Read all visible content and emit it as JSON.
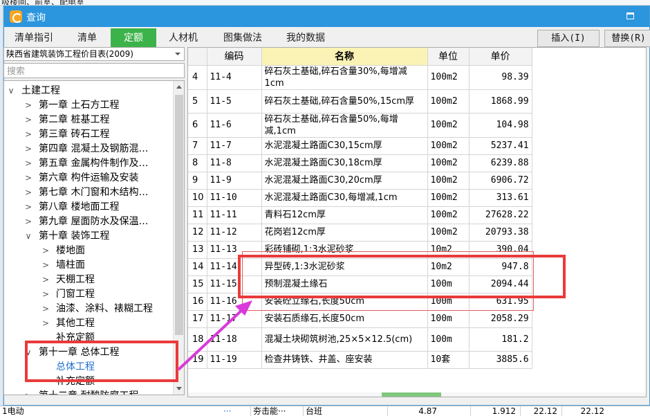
{
  "background": {
    "top_text": "吸楼间、前室、配电室",
    "bottom_cells": [
      "1电动",
      "···",
      "夯击能···",
      "台班",
      "4.87",
      "1.912",
      "22.12",
      "22.12"
    ]
  },
  "window": {
    "title": "查询",
    "logo_icon": "app-logo-icon",
    "maximize_icon": "maximize-icon",
    "accent": "#2b95dd"
  },
  "tabs": [
    {
      "label": "清单指引",
      "active": false
    },
    {
      "label": "清单",
      "active": false
    },
    {
      "label": "定额",
      "active": true
    },
    {
      "label": "人材机",
      "active": false
    },
    {
      "label": "图集做法",
      "active": false
    },
    {
      "label": "我的数据",
      "active": false
    }
  ],
  "buttons": {
    "insert": "插入(I)",
    "replace": "替换(R)"
  },
  "library_select": "陕西省建筑装饰工程价目表(2009)",
  "search_placeholder": "搜索",
  "tree": [
    {
      "label": "土建工程",
      "chev": "∨",
      "level": 0,
      "link": false
    },
    {
      "label": "第一章 土石方工程",
      "chev": ">",
      "level": 1,
      "link": false
    },
    {
      "label": "第二章 桩基工程",
      "chev": ">",
      "level": 1,
      "link": false
    },
    {
      "label": "第三章 砖石工程",
      "chev": ">",
      "level": 1,
      "link": false
    },
    {
      "label": "第四章 混凝土及钢筋混…",
      "chev": ">",
      "level": 1,
      "link": false
    },
    {
      "label": "第五章 金属构件制作及…",
      "chev": ">",
      "level": 1,
      "link": false
    },
    {
      "label": "第六章 构件运输及安装",
      "chev": ">",
      "level": 1,
      "link": false
    },
    {
      "label": "第七章 木门窗和木结构…",
      "chev": ">",
      "level": 1,
      "link": false
    },
    {
      "label": "第八章 楼地面工程",
      "chev": ">",
      "level": 1,
      "link": false
    },
    {
      "label": "第九章 屋面防水及保温…",
      "chev": ">",
      "level": 1,
      "link": false
    },
    {
      "label": "第十章 装饰工程",
      "chev": "∨",
      "level": 1,
      "link": false
    },
    {
      "label": "楼地面",
      "chev": ">",
      "level": 2,
      "link": false
    },
    {
      "label": "墙柱面",
      "chev": ">",
      "level": 2,
      "link": false
    },
    {
      "label": "天棚工程",
      "chev": ">",
      "level": 2,
      "link": false
    },
    {
      "label": "门窗工程",
      "chev": ">",
      "level": 2,
      "link": false
    },
    {
      "label": "油漆、涂料、裱糊工程",
      "chev": ">",
      "level": 2,
      "link": false
    },
    {
      "label": "其他工程",
      "chev": ">",
      "level": 2,
      "link": false
    },
    {
      "label": "补充定额",
      "chev": "",
      "level": 2,
      "link": false
    },
    {
      "label": "第十一章 总体工程",
      "chev": "∨",
      "level": 1,
      "link": false
    },
    {
      "label": "总体工程",
      "chev": "",
      "level": 2,
      "link": true
    },
    {
      "label": "补充定额",
      "chev": "",
      "level": 2,
      "link": false
    },
    {
      "label": "第十二章 耐酸防腐工程",
      "chev": ">",
      "level": 1,
      "link": false
    }
  ],
  "table": {
    "headers": [
      "",
      "编码",
      "名称",
      "单位",
      "单价"
    ],
    "rows": [
      {
        "idx": "4",
        "code": "11-4",
        "name": "碎石灰土基础,碎石含量30%,每增减1cm",
        "unit": "100m2",
        "price": "98.39"
      },
      {
        "idx": "5",
        "code": "11-5",
        "name": "碎石灰土基础,碎石含量50%,15cm厚",
        "unit": "100m2",
        "price": "1868.99"
      },
      {
        "idx": "6",
        "code": "11-6",
        "name": "碎石灰土基础,碎石含量50%,每增减,1cm",
        "unit": "100m2",
        "price": "104.98"
      },
      {
        "idx": "7",
        "code": "11-7",
        "name": "水泥混凝土路面C30,15cm厚",
        "unit": "100m2",
        "price": "5237.41"
      },
      {
        "idx": "8",
        "code": "11-8",
        "name": "水泥混凝土路面C30,18cm厚",
        "unit": "100m2",
        "price": "6239.88"
      },
      {
        "idx": "9",
        "code": "11-9",
        "name": "水泥混凝土路面C30,20cm厚",
        "unit": "100m2",
        "price": "6906.72"
      },
      {
        "idx": "10",
        "code": "11-10",
        "name": "水泥混凝土路面C30,每增减,1cm",
        "unit": "100m2",
        "price": "313.61"
      },
      {
        "idx": "11",
        "code": "11-11",
        "name": "青料石12cm厚",
        "unit": "100m2",
        "price": "27628.22"
      },
      {
        "idx": "12",
        "code": "11-12",
        "name": "花岗岩12cm厚",
        "unit": "100m2",
        "price": "20793.38"
      },
      {
        "idx": "13",
        "code": "11-13",
        "name": "彩砖铺砌,1:3水泥砂浆",
        "unit": "10m2",
        "price": "390.04"
      },
      {
        "idx": "14",
        "code": "11-14",
        "name": "异型砖,1:3水泥砂浆",
        "unit": "10m2",
        "price": "947.8"
      },
      {
        "idx": "15",
        "code": "11-15",
        "name": "预制混凝土缘石",
        "unit": "100m",
        "price": "2094.44"
      },
      {
        "idx": "16",
        "code": "11-16",
        "name": "安装砼立缘石,长度50cm",
        "unit": "100m",
        "price": "631.95"
      },
      {
        "idx": "17",
        "code": "11-17",
        "name": "安装石质缘石,长度50cm",
        "unit": "100m",
        "price": "2058.29"
      },
      {
        "idx": "18",
        "code": "11-18",
        "name": "混凝土块砌筑树池,25×5×12.5(cm)",
        "unit": "100m",
        "price": "181.2"
      },
      {
        "idx": "19",
        "code": "11-19",
        "name": "检查井铸铁、井盖、座安装",
        "unit": "10套",
        "price": "3885.6"
      }
    ]
  },
  "annotation_colors": {
    "box": "#ea3a3a",
    "arrow": "#d93ad9"
  }
}
